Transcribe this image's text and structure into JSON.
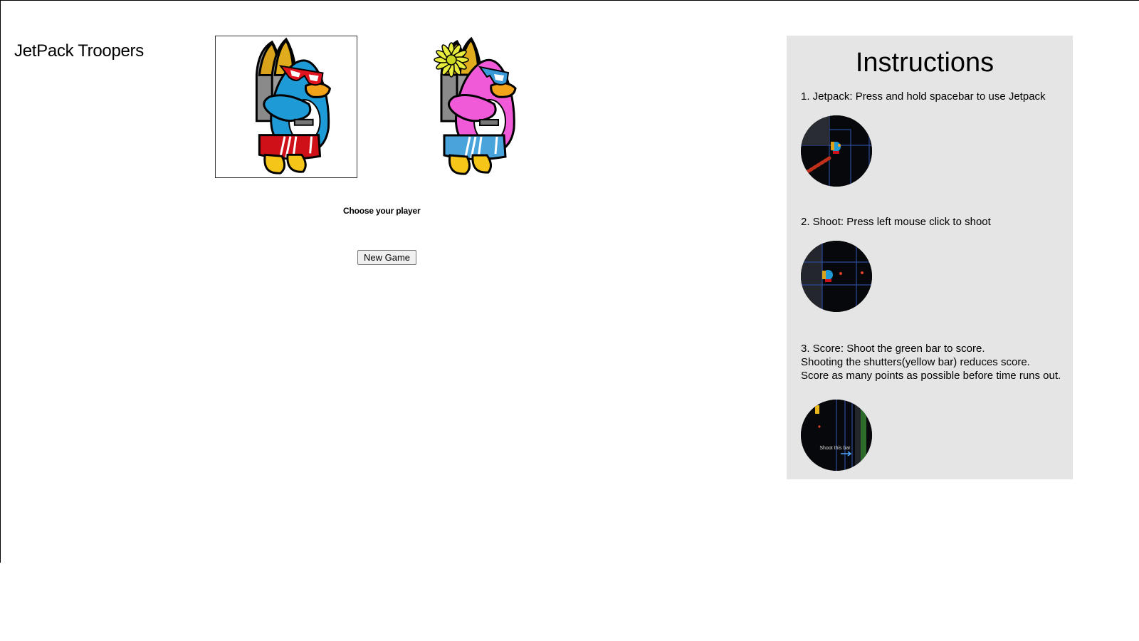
{
  "app": {
    "title": "JetPack Troopers"
  },
  "players": [
    {
      "name": "player-blue",
      "colors": {
        "body": "#1e9ad6",
        "shorts": "#cf1018",
        "glasses": "#e0141e"
      }
    },
    {
      "name": "player-pink",
      "colors": {
        "body": "#f05ad8",
        "shorts": "#4aa4dc",
        "glasses": "#3a9ad8"
      }
    }
  ],
  "selection": {
    "label": "Choose your player",
    "selected_index": 0
  },
  "buttons": {
    "new_game": "New Game"
  },
  "instructions": {
    "title": "Instructions",
    "steps": [
      {
        "lines": [
          "1. Jetpack: Press and hold spacebar to use Jetpack"
        ]
      },
      {
        "lines": [
          "2. Shoot: Press left mouse click to shoot"
        ]
      },
      {
        "lines": [
          "3. Score: Shoot the green bar to score.",
          "Shooting the shutters(yellow bar) reduces score.",
          "Score as many points as possible before time runs out."
        ],
        "thumb_caption": "Shoot this bar"
      }
    ]
  }
}
